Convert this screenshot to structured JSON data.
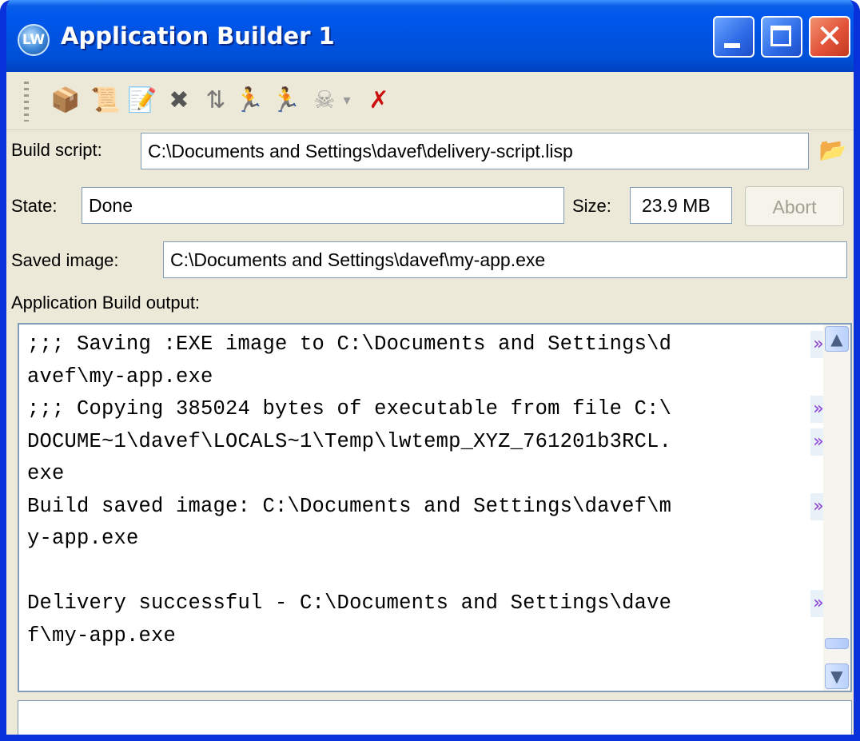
{
  "window": {
    "title": "Application Builder 1",
    "icon_text": "LW",
    "minimize_glyph": "",
    "close_glyph": "✕"
  },
  "toolbar": {
    "items": [
      {
        "name": "build-icon",
        "glyph": "📦",
        "color": "#2e7d32"
      },
      {
        "name": "view-script-icon",
        "glyph": "📜",
        "color": "#1f4fa0"
      },
      {
        "name": "edit-script-icon",
        "glyph": "📝",
        "color": "#444444"
      },
      {
        "name": "stop-icon",
        "glyph": "✖",
        "color": "#555555"
      },
      {
        "name": "sort-icon",
        "glyph": "⇅",
        "color": "#777777"
      },
      {
        "name": "run-icon",
        "glyph": "🏃",
        "color": "#222222"
      },
      {
        "name": "run-debug-icon",
        "glyph": "🏃",
        "color": "#222222"
      },
      {
        "name": "skull-icon",
        "glyph": "☠",
        "color": "#9a9a9a"
      },
      {
        "name": "dropdown-arrow-icon",
        "glyph": "▾",
        "color": "#9a9a9a"
      },
      {
        "name": "clear-icon",
        "glyph": "✗",
        "color": "#cc1010"
      }
    ]
  },
  "build_script": {
    "label": "Build script:",
    "value": "C:\\Documents and Settings\\davef\\delivery-script.lisp",
    "browse_icon": "📂"
  },
  "state": {
    "label": "State:",
    "value": "Done",
    "size_label": "Size:",
    "size_value": "23.9 MB",
    "abort_label": "Abort"
  },
  "saved_image": {
    "label": "Saved image:",
    "value": "C:\\Documents and Settings\\davef\\my-app.exe"
  },
  "output": {
    "label": "Application Build output:",
    "wrap_glyph": "»",
    "lines": [
      {
        "text": ";;; Saving :EXE image to C:\\Documents and Settings\\d",
        "wrapped": true
      },
      {
        "text": "avef\\my-app.exe",
        "wrapped": false
      },
      {
        "text": ";;; Copying 385024 bytes of executable from file C:\\",
        "wrapped": true
      },
      {
        "text": "DOCUME~1\\davef\\LOCALS~1\\Temp\\lwtemp_XYZ_761201b3RCL.",
        "wrapped": true
      },
      {
        "text": "exe",
        "wrapped": false
      },
      {
        "text": "Build saved image: C:\\Documents and Settings\\davef\\m",
        "wrapped": true
      },
      {
        "text": "y-app.exe",
        "wrapped": false
      },
      {
        "text": "",
        "wrapped": false
      },
      {
        "text": "Delivery successful - C:\\Documents and Settings\\dave",
        "wrapped": true
      },
      {
        "text": "f\\my-app.exe",
        "wrapped": false
      }
    ],
    "scroll_up_glyph": "▲",
    "scroll_down_glyph": "▼"
  },
  "colors": {
    "titlebar": "#0054e3",
    "window_bg": "#ece9d8",
    "wrap_marker": "#8a3fd1"
  }
}
